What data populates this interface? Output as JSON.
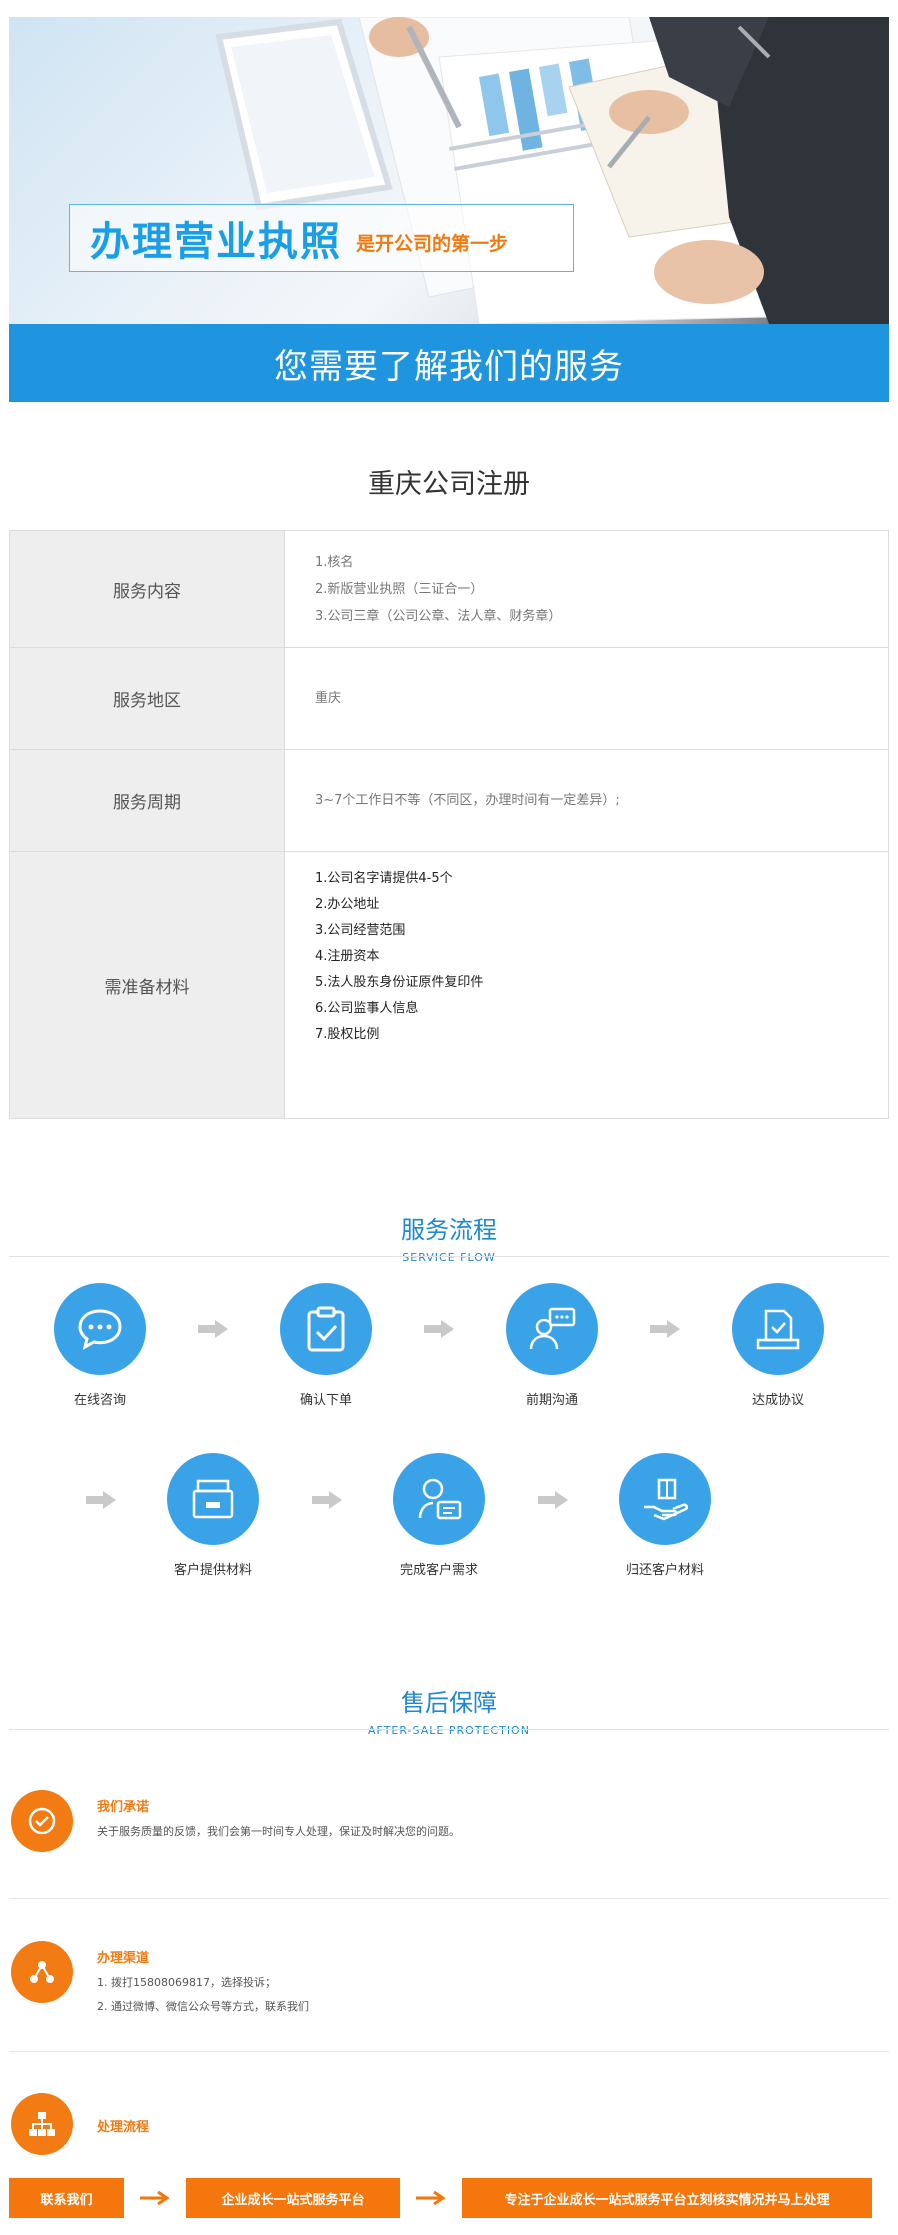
{
  "hero": {
    "headline_main": "办理营业执照",
    "headline_sub": "是开公司的第一步",
    "band_text": "您需要了解我们的服务"
  },
  "registration": {
    "title": "重庆公司注册",
    "rows": [
      {
        "label": "服务内容",
        "lines": [
          "1.核名",
          "2.新版营业执照（三证合一）",
          "3.公司三章（公司公章、法人章、财务章）"
        ]
      },
      {
        "label": "服务地区",
        "lines": [
          "重庆"
        ]
      },
      {
        "label": "服务周期",
        "lines": [
          "3~7个工作日不等（不同区，办理时间有一定差异）;"
        ]
      },
      {
        "label": "需准备材料",
        "lines": [
          "1.公司名字请提供4-5个",
          "2.办公地址",
          "3.公司经营范围",
          "4.注册资本",
          "5.法人股东身份证原件复印件",
          "6.公司监事人信息",
          "7.股权比例"
        ]
      }
    ]
  },
  "service_flow": {
    "title_cn": "服务流程",
    "title_en": "SERVICE FLOW",
    "steps": [
      {
        "label": "在线咨询",
        "icon": "chat-bubble-icon"
      },
      {
        "label": "确认下单",
        "icon": "clipboard-check-icon"
      },
      {
        "label": "前期沟通",
        "icon": "user-chat-icon"
      },
      {
        "label": "达成协议",
        "icon": "document-check-icon"
      },
      {
        "label": "客户提供材料",
        "icon": "tray-icon"
      },
      {
        "label": "完成客户需求",
        "icon": "user-card-icon"
      },
      {
        "label": "归还客户材料",
        "icon": "hand-box-icon"
      }
    ]
  },
  "after_sale": {
    "title_cn": "售后保障",
    "title_en": "AFTER-SALE PROTECTION",
    "items": [
      {
        "title": "我们承诺",
        "icon": "check-circle-icon",
        "lines": [
          "关于服务质量的反馈，我们会第一时间专人处理，保证及时解决您的问题。"
        ]
      },
      {
        "title": "办理渠道",
        "icon": "share-nodes-icon",
        "lines": [
          "1. 拨打15808069817，选择投诉；",
          "2. 通过微博、微信公众号等方式，联系我们"
        ]
      },
      {
        "title": "处理流程",
        "icon": "org-chart-icon",
        "lines": []
      }
    ],
    "process": [
      "联系我们",
      "企业成长一站式服务平台",
      "专注于企业成长一站式服务平台立刻核实情况并马上处理"
    ]
  },
  "colors": {
    "brand_blue": "#1e95de",
    "icon_blue": "#3aa3e8",
    "accent_orange": "#f5760c"
  }
}
